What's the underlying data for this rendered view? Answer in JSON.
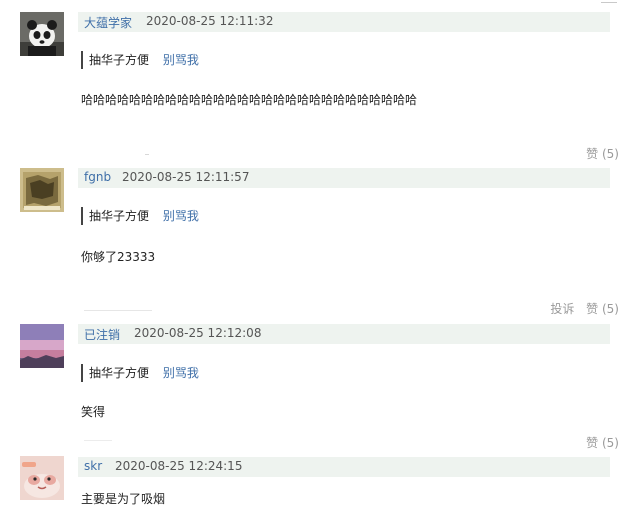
{
  "comments": [
    {
      "username": "大蕴学家",
      "timestamp": "2020-08-25 12:11:32",
      "quote_author": "抽华子方便",
      "quote_link": "别骂我",
      "content": "哈哈哈哈哈哈哈哈哈哈哈哈哈哈哈哈哈哈哈哈哈哈哈哈哈哈哈哈",
      "report": "",
      "like": "赞 (5)"
    },
    {
      "username": "fgnb",
      "timestamp": "2020-08-25 12:11:57",
      "quote_author": "抽华子方便",
      "quote_link": "别骂我",
      "content": "你够了23333",
      "report": "投诉",
      "like": "赞 (5)"
    },
    {
      "username": "已注销",
      "timestamp": "2020-08-25 12:12:08",
      "quote_author": "抽华子方便",
      "quote_link": "别骂我",
      "content": "笑得",
      "report": "",
      "like": "赞 (5)"
    },
    {
      "username": "skr",
      "timestamp": "2020-08-25 12:24:15",
      "quote_author": "",
      "quote_link": "",
      "content": "主要是为了吸烟",
      "report": "",
      "like": ""
    }
  ],
  "avatars": [
    {
      "icon": "panda-avatar-icon",
      "bg": "#5a5a55"
    },
    {
      "icon": "map-avatar-icon",
      "bg": "#c8b98a"
    },
    {
      "icon": "sunset-avatar-icon",
      "bg": "#b28fb8"
    },
    {
      "icon": "cartoon-avatar-icon",
      "bg": "#e9c7c0"
    }
  ],
  "colors": {
    "header_bg": "#eef3ef",
    "username": "#3f6fa8",
    "link": "#3f6fa8",
    "muted": "#9a9a9a"
  }
}
